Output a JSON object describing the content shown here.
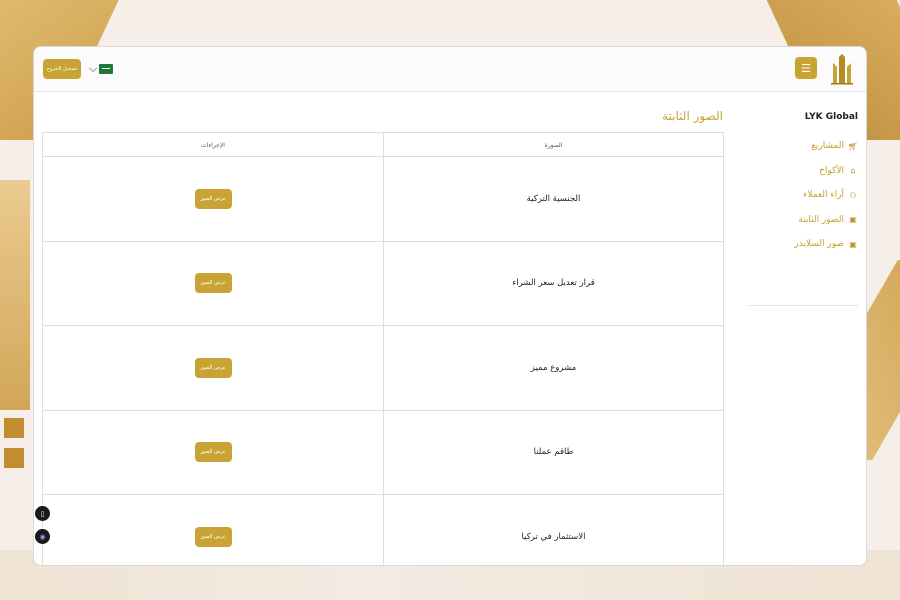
{
  "header": {
    "logout_label": "تسجيل الخروج",
    "menu_icon": "hamburger-icon",
    "language_flag": "saudi-flag-icon"
  },
  "sidebar": {
    "brand": "LYK Global",
    "items": [
      {
        "label": "المشاريع",
        "icon": "cart-icon"
      },
      {
        "label": "الأكواخ",
        "icon": "home-icon"
      },
      {
        "label": "آراء العملاء",
        "icon": "users-icon"
      },
      {
        "label": "الصور الثابتة",
        "icon": "image-icon"
      },
      {
        "label": "صور السلايدر",
        "icon": "image-icon"
      }
    ]
  },
  "main": {
    "title": "الصور الثابتة",
    "table": {
      "columns": [
        "الصورة",
        "الإجراءات"
      ],
      "rows": [
        {
          "title": "الجنسية التركية",
          "action": "عرض الصور"
        },
        {
          "title": "قرار تعديل سعر الشراء",
          "action": "عرض الصور"
        },
        {
          "title": "مشروع مميز",
          "action": "عرض الصور"
        },
        {
          "title": "طاقم عملنا",
          "action": "عرض الصور"
        },
        {
          "title": "الاستثمار في تركيا",
          "action": "عرض الصور"
        }
      ]
    }
  },
  "colors": {
    "accent": "#c9a434",
    "background": "#f6efe9"
  }
}
